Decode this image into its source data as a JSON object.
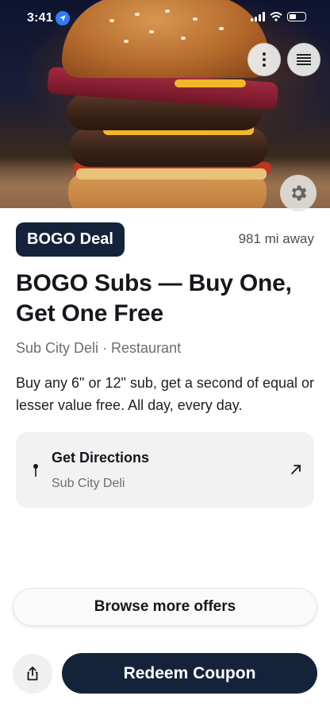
{
  "status_bar": {
    "time": "3:41"
  },
  "hero": {
    "image_alt": "Stacked burger with pastrami, cheese and peppers"
  },
  "header_actions": {
    "more_icon": "more-vertical-icon",
    "menu_icon": "hamburger-menu-icon",
    "settings_icon": "gear-icon"
  },
  "offer": {
    "badge": "BOGO Deal",
    "distance": "981 mi away",
    "title": "BOGO Subs — Buy One, Get One Free",
    "merchant": "Sub City Deli · Restaurant",
    "description": "Buy any 6\" or 12\" sub, get a second of equal or lesser value free. All day, every day."
  },
  "directions": {
    "title": "Get Directions",
    "subtitle": "Sub City Deli",
    "pin_icon": "map-pin-icon",
    "arrow_icon": "arrow-up-right-icon"
  },
  "actions": {
    "browse_label": "Browse more offers",
    "redeem_label": "Redeem Coupon",
    "share_icon": "share-icon"
  },
  "colors": {
    "primary": "#14223a",
    "location_blue": "#2f7cf6"
  }
}
